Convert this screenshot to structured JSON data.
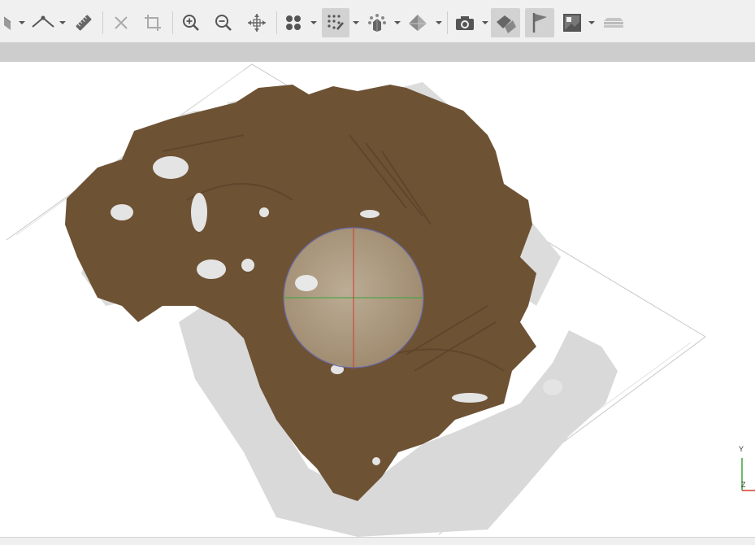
{
  "toolbar": {
    "tools": [
      {
        "name": "select-tool",
        "icon": "select-icon",
        "has_dropdown": true
      },
      {
        "name": "measure-angle-tool",
        "icon": "angle-icon",
        "has_dropdown": true
      },
      {
        "name": "ruler-tool",
        "icon": "ruler-icon",
        "has_dropdown": false
      },
      {
        "name": "reset-tool",
        "icon": "close-icon",
        "has_dropdown": false
      },
      {
        "name": "crop-tool",
        "icon": "crop-icon",
        "has_dropdown": false
      },
      {
        "name": "zoom-in-tool",
        "icon": "zoom-in-icon",
        "has_dropdown": false
      },
      {
        "name": "zoom-out-tool",
        "icon": "zoom-out-icon",
        "has_dropdown": false
      },
      {
        "name": "move-tool",
        "icon": "move-icon",
        "has_dropdown": false
      },
      {
        "name": "points-view-tool",
        "icon": "points-icon",
        "has_dropdown": true
      },
      {
        "name": "dense-cloud-view-tool",
        "icon": "dense-cloud-icon",
        "has_dropdown": true
      },
      {
        "name": "tiled-model-tool",
        "icon": "tiled-model-icon",
        "has_dropdown": true
      },
      {
        "name": "mesh-view-tool",
        "icon": "mesh-icon",
        "has_dropdown": true
      },
      {
        "name": "show-cameras-tool",
        "icon": "camera-icon",
        "has_dropdown": true
      },
      {
        "name": "show-shapes-tool",
        "icon": "shapes-icon",
        "has_dropdown": false,
        "active": true
      },
      {
        "name": "show-markers-tool",
        "icon": "flag-icon",
        "has_dropdown": false,
        "active": true
      },
      {
        "name": "show-images-tool",
        "icon": "image-icon",
        "has_dropdown": true
      },
      {
        "name": "layers-tool",
        "icon": "layers-icon",
        "has_dropdown": false
      }
    ]
  },
  "viewport": {
    "axes": {
      "y_label": "Y",
      "z_label": "Z"
    },
    "colors": {
      "terrain": "#6e5234",
      "terrain_dark": "#5a4228",
      "points": "#d9d9d9",
      "trackball_fill": "#b9aa92",
      "trackball_outline": "#6a6aa8",
      "axis_red": "#d23a2a",
      "axis_green": "#3aa53a",
      "bounding_box": "#c8c8c8"
    }
  }
}
